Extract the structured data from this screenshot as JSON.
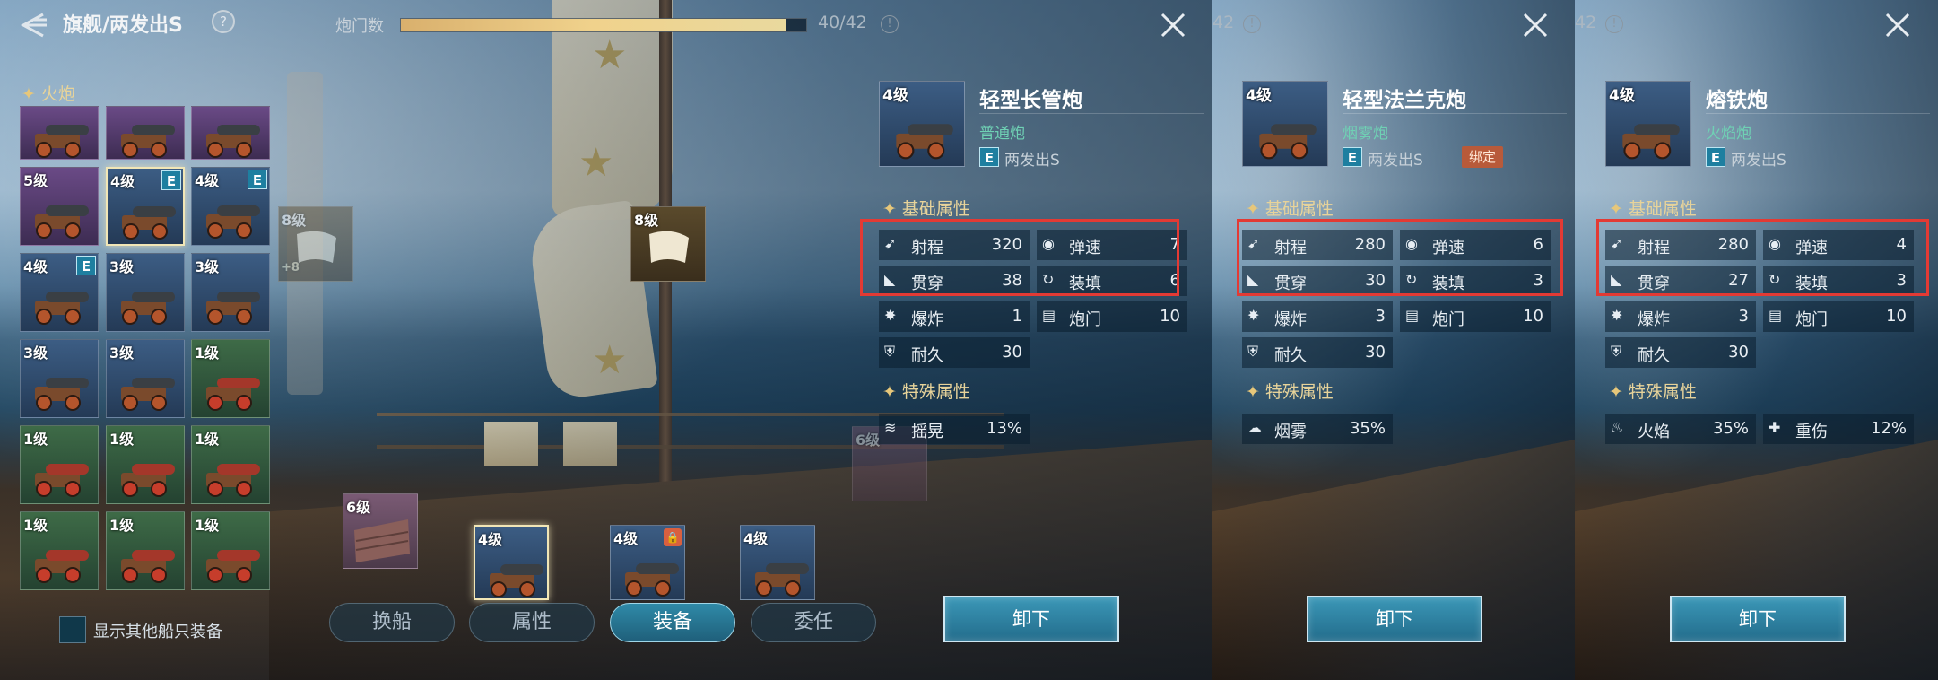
{
  "header": {
    "title": "旗舰/两发出S",
    "help_glyph": "?",
    "port_label": "炮门数",
    "port_value": "40/42",
    "port_progress": 0.952,
    "info_glyph": "!"
  },
  "inventory": {
    "category": "火炮",
    "cells": [
      {
        "level": "",
        "rarity": "purple",
        "badge": "",
        "selected": false
      },
      {
        "level": "",
        "rarity": "purple",
        "badge": "",
        "selected": false
      },
      {
        "level": "",
        "rarity": "purple",
        "badge": "",
        "selected": false
      },
      {
        "level": "5级",
        "rarity": "purple",
        "badge": "",
        "selected": false
      },
      {
        "level": "4级",
        "rarity": "blue",
        "badge": "E",
        "selected": true
      },
      {
        "level": "4级",
        "rarity": "blue",
        "badge": "E",
        "selected": false
      },
      {
        "level": "4级",
        "rarity": "blue",
        "badge": "E",
        "selected": false
      },
      {
        "level": "3级",
        "rarity": "blue",
        "badge": "",
        "selected": false
      },
      {
        "level": "3级",
        "rarity": "blue",
        "badge": "",
        "selected": false
      },
      {
        "level": "3级",
        "rarity": "blue",
        "badge": "",
        "selected": false
      },
      {
        "level": "3级",
        "rarity": "blue",
        "badge": "",
        "selected": false
      },
      {
        "level": "1级",
        "rarity": "green",
        "badge": "",
        "selected": false
      },
      {
        "level": "1级",
        "rarity": "green",
        "badge": "",
        "selected": false
      },
      {
        "level": "1级",
        "rarity": "green",
        "badge": "",
        "selected": false
      },
      {
        "level": "1级",
        "rarity": "green",
        "badge": "",
        "selected": false
      },
      {
        "level": "1级",
        "rarity": "green",
        "badge": "",
        "selected": false
      },
      {
        "level": "1级",
        "rarity": "green",
        "badge": "",
        "selected": false
      },
      {
        "level": "1级",
        "rarity": "green",
        "badge": "",
        "selected": false
      }
    ],
    "show_other_label": "显示其他船只装备"
  },
  "deck": {
    "sail_slots": [
      {
        "level": "8级",
        "extra": "+8"
      },
      {
        "level": "8级",
        "extra": ""
      }
    ],
    "plank_slots": [
      {
        "level": "6级"
      },
      {
        "level": "6级"
      }
    ],
    "cannon_slots": [
      {
        "level": "4级",
        "locked": false,
        "selected": true
      },
      {
        "level": "4级",
        "locked": true,
        "selected": false
      },
      {
        "level": "4级",
        "locked": false,
        "selected": false
      }
    ]
  },
  "tabs": [
    "换船",
    "属性",
    "装备",
    "委任"
  ],
  "active_tab": "装备",
  "panels": [
    {
      "level": "4级",
      "name": "轻型长管炮",
      "subtype": "普通炮",
      "badge": "E",
      "ship": "两发出S",
      "bound_tag": "",
      "base_title": "基础属性",
      "base_stats": [
        {
          "label": "射程",
          "value": "320",
          "icon": "range-icon"
        },
        {
          "label": "弹速",
          "value": "7",
          "icon": "shell-speed-icon"
        },
        {
          "label": "贯穿",
          "value": "38",
          "icon": "pierce-icon"
        },
        {
          "label": "装填",
          "value": "6",
          "icon": "reload-icon"
        },
        {
          "label": "爆炸",
          "value": "1",
          "icon": "explosion-icon"
        },
        {
          "label": "炮门",
          "value": "10",
          "icon": "port-icon"
        },
        {
          "label": "耐久",
          "value": "30",
          "icon": "durability-icon"
        }
      ],
      "special_title": "特殊属性",
      "special_stats": [
        {
          "label": "摇晃",
          "value": "13%",
          "icon": "shake-icon"
        }
      ],
      "unequip_label": "卸下"
    },
    {
      "level": "4级",
      "name": "轻型法兰克炮",
      "subtype": "烟雾炮",
      "badge": "E",
      "ship": "两发出S",
      "bound_tag": "绑定",
      "base_title": "基础属性",
      "base_stats": [
        {
          "label": "射程",
          "value": "280",
          "icon": "range-icon"
        },
        {
          "label": "弹速",
          "value": "6",
          "icon": "shell-speed-icon"
        },
        {
          "label": "贯穿",
          "value": "30",
          "icon": "pierce-icon"
        },
        {
          "label": "装填",
          "value": "3",
          "icon": "reload-icon"
        },
        {
          "label": "爆炸",
          "value": "3",
          "icon": "explosion-icon"
        },
        {
          "label": "炮门",
          "value": "10",
          "icon": "port-icon"
        },
        {
          "label": "耐久",
          "value": "30",
          "icon": "durability-icon"
        }
      ],
      "special_title": "特殊属性",
      "special_stats": [
        {
          "label": "烟雾",
          "value": "35%",
          "icon": "smoke-icon"
        }
      ],
      "unequip_label": "卸下"
    },
    {
      "level": "4级",
      "name": "熔铁炮",
      "subtype": "火焰炮",
      "badge": "E",
      "ship": "两发出S",
      "bound_tag": "",
      "base_title": "基础属性",
      "base_stats": [
        {
          "label": "射程",
          "value": "280",
          "icon": "range-icon"
        },
        {
          "label": "弹速",
          "value": "4",
          "icon": "shell-speed-icon"
        },
        {
          "label": "贯穿",
          "value": "27",
          "icon": "pierce-icon"
        },
        {
          "label": "装填",
          "value": "3",
          "icon": "reload-icon"
        },
        {
          "label": "爆炸",
          "value": "3",
          "icon": "explosion-icon"
        },
        {
          "label": "炮门",
          "value": "10",
          "icon": "port-icon"
        },
        {
          "label": "耐久",
          "value": "30",
          "icon": "durability-icon"
        }
      ],
      "special_title": "特殊属性",
      "special_stats": [
        {
          "label": "火焰",
          "value": "35%",
          "icon": "fire-icon"
        },
        {
          "label": "重伤",
          "value": "12%",
          "icon": "heavy-wound-icon"
        }
      ],
      "unequip_label": "卸下"
    }
  ],
  "fragments": {
    "b_port_value": "42",
    "c_port_value": "42"
  },
  "colors": {
    "accent": "#2f8aa8",
    "gold": "#e7d39a",
    "subtype_green": "#6fd1b4",
    "highlight_red": "#e33a34",
    "bound_tag": "#b85a3a"
  }
}
